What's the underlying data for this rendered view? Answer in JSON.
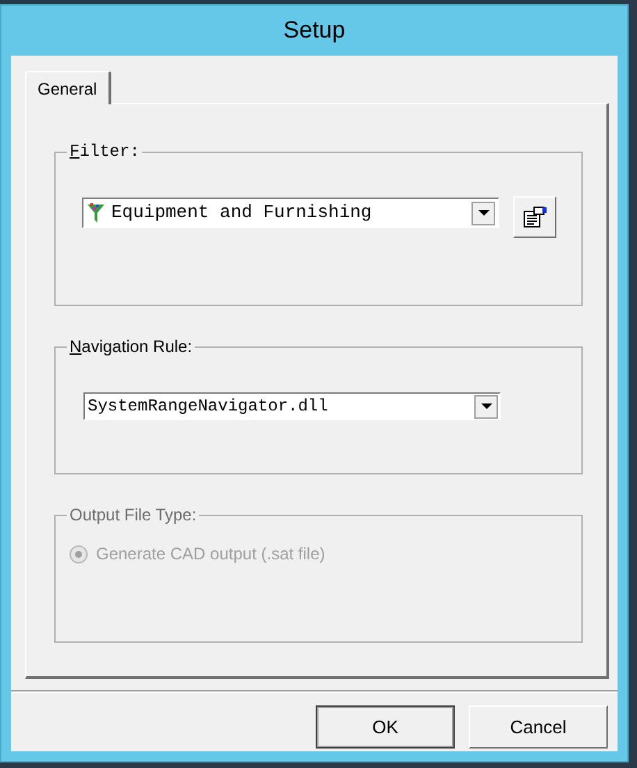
{
  "window": {
    "title": "Setup"
  },
  "tabs": [
    {
      "label": "General",
      "selected": true
    }
  ],
  "filter": {
    "label": "Filter:",
    "mnemonic": true,
    "value": "Equipment and Furnishing"
  },
  "navigation_rule": {
    "label": "Navigation Rule:",
    "mnemonic": true,
    "value": "SystemRangeNavigator.dll"
  },
  "output_file_type": {
    "label": "Output File Type:",
    "disabled": true,
    "options": [
      {
        "label": "Generate CAD output (.sat file)",
        "selected": true
      }
    ]
  },
  "buttons": [
    {
      "label": "OK",
      "default": true
    },
    {
      "label": "Cancel",
      "default": false
    }
  ]
}
